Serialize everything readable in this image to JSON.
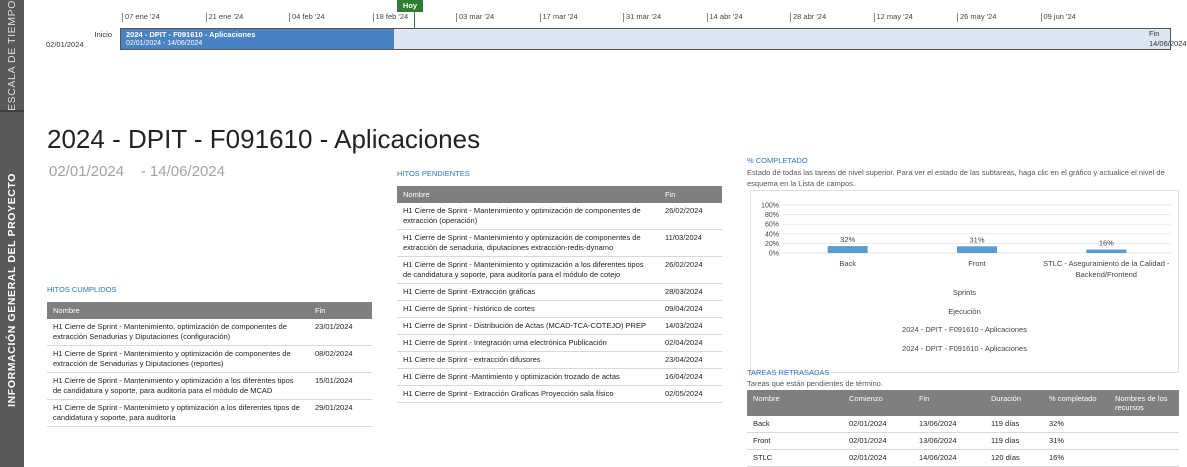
{
  "sidebar": {
    "timescale_label": "ESCALA DE TIEMPO",
    "info_label": "INFORMACIÓN GENERAL DEL PROYECTO"
  },
  "timeline": {
    "ticks": [
      "07 ene '24",
      "21 ene '24",
      "04 feb '24",
      "18 feb '24",
      "03 mar '24",
      "17 mar '24",
      "31 mar '24",
      "14 abr '24",
      "28 abr '24",
      "12 may '24",
      "26 may '24",
      "09 jun '24"
    ],
    "today_label": "Hoy",
    "start_label": "Inicio",
    "start_date": "02/01/2024",
    "end_label": "Fin",
    "end_date": "14/06/2024",
    "bar_title": "2024 - DPIT - F091610 - Aplicaciones",
    "bar_dates": "02/01/2024 - 14/06/2024",
    "bar_progress": 0.26
  },
  "project": {
    "title": "2024 - DPIT - F091610 - Aplicaciones",
    "date_range": "02/01/2024    - 14/06/2024"
  },
  "hitos_cumplidos": {
    "title": "HITOS CUMPLIDOS",
    "headers": [
      "Nombre",
      "Fin"
    ],
    "rows": [
      [
        "H1 Cierre de Sprint - Mantenimiento, optimización de componentes de extracción Senadurias y Diputaciones (configuración)",
        "23/01/2024"
      ],
      [
        "H1 Cierre de Sprint - Mantenimiento y optimización de componentes de extracción de  Senadurias y Diputaciones (reportes)",
        "08/02/2024"
      ],
      [
        "H1 Cierre de Sprint -  Mantenimiento y optimización  a los diferentes tipos de candidatura y soporte, para auditoría para el módulo de MCAD",
        "15/01/2024"
      ],
      [
        "H1 Cierre de Sprint - Mantenimieto y optimización  a los diferentes tipos de candidatura y soporte, para auditoría",
        "29/01/2024"
      ]
    ]
  },
  "hitos_pendientes": {
    "title": "HITOS PENDIENTES",
    "headers": [
      "Nombre",
      "Fin"
    ],
    "rows": [
      [
        "H1 Cierre de Sprint -  Mantenimiento y optimización de componentes de extracción (operación)",
        "26/02/2024"
      ],
      [
        "H1 Cierre de Sprint - Mantenimiento y optimización de componentes de extracción de senaduria, diputaciones extracción-redis-dynamo",
        "11/03/2024"
      ],
      [
        "H1 Cierre de Sprint - Mantenimiento y optimización a los diferentes tipos de candidatura y soporte, para auditoría para el módulo de cotejo",
        "26/02/2024"
      ],
      [
        "H1 Cierre de Sprint -Extracción gráficas",
        "28/03/2024"
      ],
      [
        "H1 Cierre de Sprint -  histórico de cortes",
        "09/04/2024"
      ],
      [
        "H1 Cierre de Sprint -  Distribución  de Actas (MCAD-TCA-COTEJO) PREP",
        "14/03/2024"
      ],
      [
        "H1 Cierre de Sprint - Integración urna electrónica Publicación",
        "02/04/2024"
      ],
      [
        "H1 Cierre de Sprint - extracción difusores",
        "23/04/2024"
      ],
      [
        "H1 Cierre de Sprint -Mantimiento y optimización  trozado de actas",
        "16/04/2024"
      ],
      [
        "H1 Cierre de Sprint - Extracción Graficas Proyección sala físico",
        "02/05/2024"
      ]
    ]
  },
  "completado": {
    "title": "% COMPLETADO",
    "description": "Estado de todas las tareas de nivel superior. Para ver el estado de las subtareas, haga clic en el gráfico y actualice el nivel de esquema en la Lista de campos.",
    "x_title": "Sprints",
    "legend_lines": [
      "Ejecución",
      "2024 - DPIT - F091610 - Aplicaciones",
      "2024 - DPIT - F091610 - Aplicaciones"
    ]
  },
  "chart_data": {
    "type": "bar",
    "categories": [
      "Back",
      "Front",
      "STLC - Aseguramiento de la Calidad - Backend/Frontend"
    ],
    "values": [
      32,
      31,
      16
    ],
    "value_labels": [
      "32%",
      "31%",
      "16%"
    ],
    "y_ticks": [
      "100%",
      "80%",
      "60%",
      "40%",
      "20%",
      "0%"
    ],
    "ylim": [
      0,
      100
    ],
    "xlabel": "Sprints",
    "ylabel": "",
    "bar_color": "#5b9bd5",
    "grid": true
  },
  "tareas_retrasadas": {
    "title": "TAREAS RETRASADAS",
    "subtitle": "Tareas que están pendientes de término.",
    "headers": [
      "Nombre",
      "Comienzo",
      "Fin",
      "Duración",
      "% completado",
      "Nombres de los recursos"
    ],
    "rows": [
      [
        "Back",
        "02/01/2024",
        "13/06/2024",
        "119 días",
        "32%",
        ""
      ],
      [
        "Front",
        "02/01/2024",
        "13/06/2024",
        "119 días",
        "31%",
        ""
      ],
      [
        "STLC",
        "02/01/2024",
        "14/06/2024",
        "120 días",
        "16%",
        ""
      ]
    ]
  },
  "colors": {
    "sidebar": "#595959",
    "accent_blue": "#2e75b6",
    "bar_blue": "#4a83c4",
    "today_green": "#2e7d32",
    "header_grey": "#7f7f7f"
  }
}
